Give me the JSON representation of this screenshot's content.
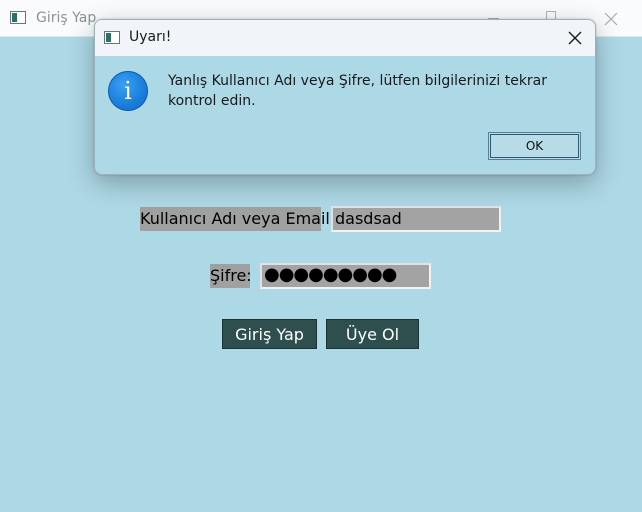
{
  "main_window": {
    "title": "Giriş Yap",
    "background": "#add8e6"
  },
  "form": {
    "username_label": "Kullanıcı Adı veya Email:",
    "username_value": "dasdsad",
    "password_label": "Şifre:",
    "password_value": "●●●●●●●●●",
    "login_button": "Giriş Yap",
    "register_button": "Üye Ol",
    "button_color": "#2f4f4f",
    "label_background": "#a0a0a0"
  },
  "dialog": {
    "title": "Uyarı!",
    "icon": "info-icon",
    "icon_glyph": "i",
    "message": "Yanlış Kullanıcı Adı veya Şifre, lütfen bilgilerinizi tekrar kontrol edin.",
    "ok_button": "OK"
  },
  "icons": {
    "app_icon": "window-app-icon",
    "minimize": "minimize-icon",
    "maximize": "maximize-icon",
    "close": "close-icon"
  }
}
